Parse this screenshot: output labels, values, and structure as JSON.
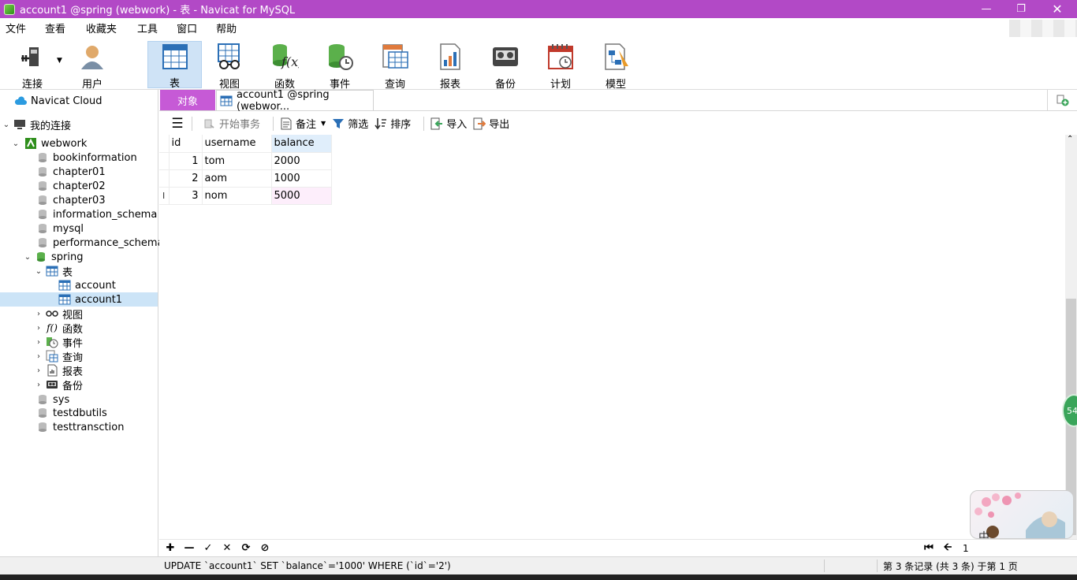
{
  "window": {
    "title": "account1 @spring (webwork) - 表 - Navicat for MySQL"
  },
  "menu": [
    "文件",
    "查看",
    "收藏夹",
    "工具",
    "窗口",
    "帮助"
  ],
  "toolbar": [
    {
      "label": "连接",
      "icon": "plug-connection-icon"
    },
    {
      "label": "用户",
      "icon": "user-icon"
    },
    {
      "label": "表",
      "icon": "table-icon",
      "active": true
    },
    {
      "label": "视图",
      "icon": "glasses-view-icon"
    },
    {
      "label": "函数",
      "icon": "function-icon"
    },
    {
      "label": "事件",
      "icon": "event-clock-icon"
    },
    {
      "label": "查询",
      "icon": "query-icon"
    },
    {
      "label": "报表",
      "icon": "report-icon"
    },
    {
      "label": "备份",
      "icon": "backup-icon"
    },
    {
      "label": "计划",
      "icon": "schedule-calendar-icon"
    },
    {
      "label": "模型",
      "icon": "model-icon"
    }
  ],
  "tree": {
    "cloud": "Navicat Cloud",
    "my_connections": "我的连接",
    "connection": "webwork",
    "databases_before": [
      "bookinformation",
      "chapter01",
      "chapter02",
      "chapter03",
      "information_schema",
      "mysql",
      "performance_schema"
    ],
    "open_db": "spring",
    "tables_folder": "表",
    "tables": [
      "account",
      "account1"
    ],
    "folders": [
      "视图",
      "函数",
      "事件",
      "查询",
      "报表",
      "备份"
    ],
    "databases_after": [
      "sys",
      "testdbutils",
      "testtransction"
    ]
  },
  "tabs": {
    "objects": "对象",
    "active": "account1 @spring (webwor..."
  },
  "subtoolbar": {
    "begin_transaction": "开始事务",
    "memo": "备注",
    "filter": "筛选",
    "sort": "排序",
    "import": "导入",
    "export": "导出"
  },
  "table": {
    "columns": [
      "id",
      "username",
      "balance"
    ],
    "rows": [
      [
        "1",
        "tom",
        "2000"
      ],
      [
        "2",
        "aom",
        "1000"
      ],
      [
        "3",
        "nom",
        "5000"
      ]
    ],
    "cursor_marker": "I"
  },
  "pager": {
    "page": "1"
  },
  "status": {
    "sql": "UPDATE `account1` SET `balance`='1000' WHERE (`id`='2')",
    "records": "第 3 条记录 (共 3 条) 于第 1 页"
  },
  "badge": "54",
  "deco_text": "中",
  "colors": {
    "titlebar": "#b249c6",
    "objects_tab": "#c65ad6",
    "selected": "#cce4f7"
  }
}
